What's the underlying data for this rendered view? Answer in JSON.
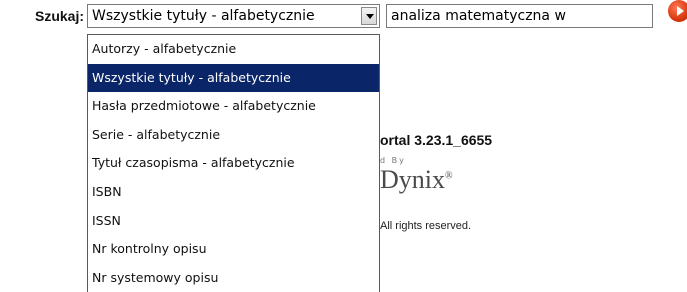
{
  "search": {
    "label": "Szukaj:",
    "selected_type": "Wszystkie tytuły - alfabetycznie",
    "query_value": "analiza matematyczna w",
    "go_icon": "arrow-right-circle-icon",
    "go_color": "#d9380f"
  },
  "dropdown": {
    "selected_color": "#0a2568",
    "items": [
      {
        "label": "Autorzy - alfabetycznie"
      },
      {
        "label": "Wszystkie tytuły - alfabetycznie"
      },
      {
        "label": "Hasła przedmiotowe - alfabetycznie"
      },
      {
        "label": "Serie - alfabetycznie"
      },
      {
        "label": "Tytuł czasopisma - alfabetycznie"
      },
      {
        "label": "ISBN"
      },
      {
        "label": "ISSN"
      },
      {
        "label": "Nr kontrolny opisu"
      },
      {
        "label": "Nr systemowy opisu"
      }
    ]
  },
  "background": {
    "version": "ortal 3.23.1_6655",
    "powered_by": "d By",
    "logo": "Dynix",
    "logo_mark": "®",
    "rights": "All rights reserved."
  }
}
